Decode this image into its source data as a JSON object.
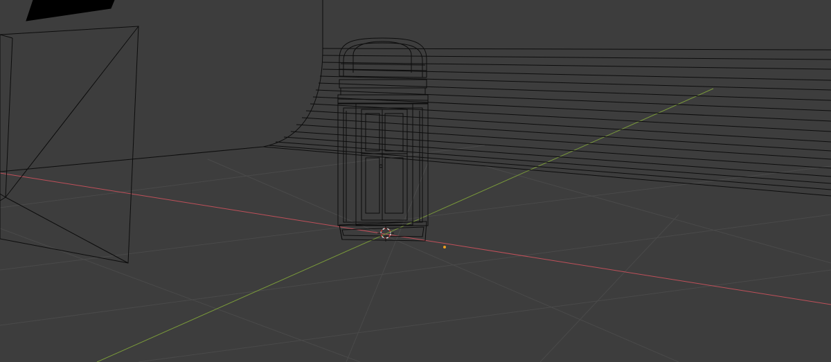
{
  "viewport": {
    "mode": "wireframe",
    "background_color": "#3d3d3d",
    "grid_color": "#4a4a4a",
    "x_axis_color": "#c0505a",
    "y_axis_color": "#7a9a3a",
    "wire_color": "#0c0c0c",
    "cursor_color": "#e0e0e0",
    "cursor_accent": "#c03030",
    "origin_color": "#f0a020"
  },
  "objects": [
    {
      "name": "backdrop-plane",
      "type": "mesh"
    },
    {
      "name": "camera",
      "type": "camera"
    },
    {
      "name": "booth",
      "type": "mesh"
    }
  ]
}
